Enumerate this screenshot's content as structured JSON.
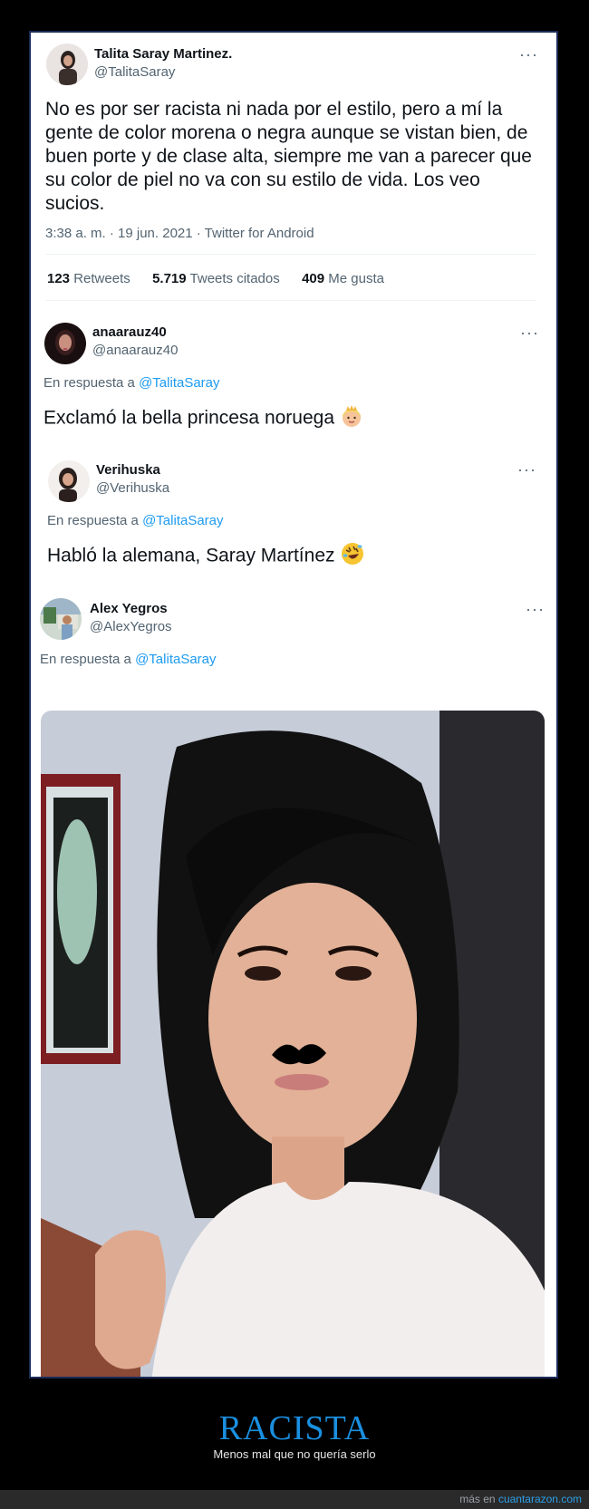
{
  "tweet": {
    "author_name": "Talita Saray Martinez.",
    "author_handle": "@TalitaSaray",
    "more": "···",
    "text": "No es por ser racista ni nada por el estilo, pero a mí la gente de color morena o negra aunque se vistan bien, de buen porte y de clase alta, siempre me van a parecer que su color de piel no va con su estilo de vida. Los veo sucios.",
    "meta": "3:38 a. m. · 19 jun. 2021 · Twitter for Android",
    "stats": [
      {
        "count": "123",
        "label": "Retweets"
      },
      {
        "count": "5.719",
        "label": "Tweets citados"
      },
      {
        "count": "409",
        "label": "Me gusta"
      }
    ]
  },
  "replies": [
    {
      "author_name": "anaarauz40",
      "author_handle": "@anaarauz40",
      "more": "···",
      "reply_prefix": "En respuesta a",
      "reply_mention": "@TalitaSaray",
      "text": "Exclamó la bella princesa noruega",
      "emoji": "princess-emoji"
    },
    {
      "author_name": "Verihuska",
      "author_handle": "@Verihuska",
      "more": "···",
      "reply_prefix": "En respuesta a",
      "reply_mention": "@TalitaSaray",
      "text": "Habló la alemana, Saray Martínez",
      "emoji": "rolling-laughing-emoji"
    },
    {
      "author_name": "Alex Yegros",
      "author_handle": "@AlexYegros",
      "more": "···",
      "reply_prefix": "En respuesta a",
      "reply_mention": "@TalitaSaray",
      "media": "photo"
    }
  ],
  "footer": {
    "title": "RACISTA",
    "subtitle": "Menos mal que no quería serlo",
    "more_prefix": "más en",
    "more_site": "cuantarazon.com"
  },
  "colors": {
    "link": "#1d9bf0",
    "accent_title": "#1a8fe0",
    "frame_border": "#1c2c5a"
  }
}
